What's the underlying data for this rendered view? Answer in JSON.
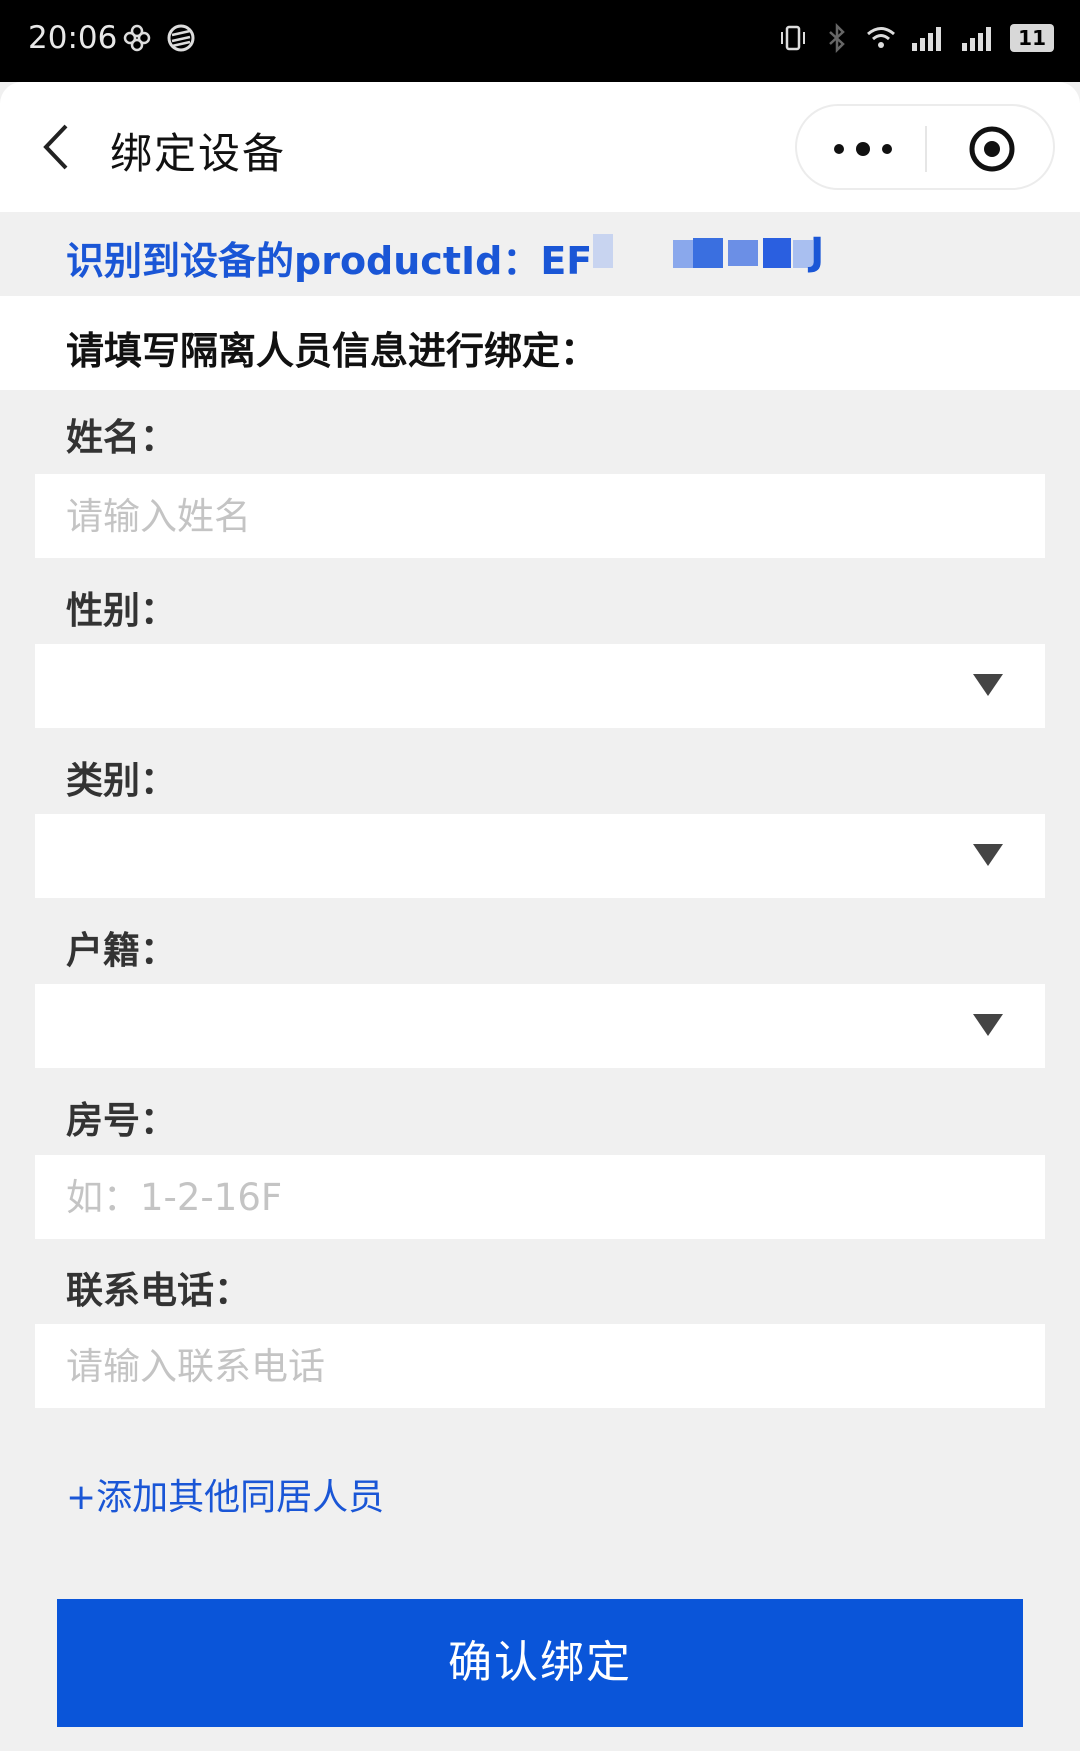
{
  "status_bar": {
    "time": "20:06",
    "battery": "11",
    "icons": [
      "flower-icon",
      "carrier-icon",
      "vibrate-icon",
      "bluetooth-icon",
      "wifi-icon",
      "signal-icon",
      "signal-2-icon",
      "battery-icon"
    ]
  },
  "nav": {
    "title": "绑定设备",
    "back_icon": "chevron-left-icon",
    "more_icon": "more-dots-icon",
    "target_icon": "target-icon"
  },
  "product": {
    "label": "识别到设备的productId：EF",
    "value": "J"
  },
  "section_title": "请填写隔离人员信息进行绑定：",
  "form": {
    "name": {
      "label": "姓名：",
      "placeholder": "请输入姓名"
    },
    "gender": {
      "label": "性别："
    },
    "category": {
      "label": "类别："
    },
    "residence": {
      "label": "户籍："
    },
    "room": {
      "label": "房号：",
      "placeholder": "如：1-2-16F"
    },
    "phone": {
      "label": "联系电话：",
      "placeholder": "请输入联系电话"
    }
  },
  "add_link": "+添加其他同居人员",
  "confirm_button": "确认绑定",
  "colors": {
    "accent": "#0a55d9",
    "link": "#1a56d6",
    "background": "#f0f0f0"
  }
}
